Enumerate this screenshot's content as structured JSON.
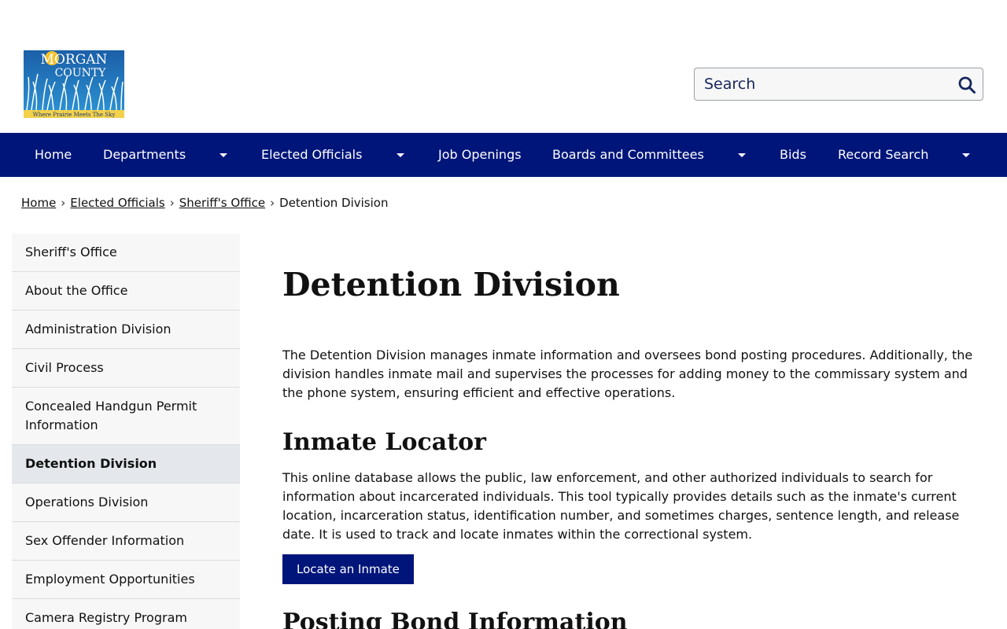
{
  "header": {
    "logo_alt": "Morgan County - Where Prairie Meets The Sky",
    "logo_title_line1": "MORGAN",
    "logo_title_line2": "COUNTY",
    "logo_tagline": "Where Prairie Meets The Sky",
    "search_placeholder": "Search"
  },
  "nav": {
    "items": [
      "Home",
      "Departments",
      "Elected Officials",
      "Job Openings",
      "Boards and Committees",
      "Bids",
      "Record Search"
    ]
  },
  "breadcrumb": {
    "items": [
      "Home",
      "Elected Officials",
      "Sheriff's Office",
      "Detention Division"
    ],
    "separator": "›"
  },
  "sidebar": {
    "items": [
      "Sheriff's Office",
      "About the Office",
      "Administration Division",
      "Civil Process",
      "Concealed Handgun Permit Information",
      "Detention Division",
      "Operations Division",
      "Sex Offender Information",
      "Employment Opportunities",
      "Camera Registry Program"
    ],
    "active": "Detention Division"
  },
  "main": {
    "title": "Detention Division",
    "intro": "The Detention Division manages inmate information and oversees bond posting procedures. Additionally, the division handles inmate mail and supervises the processes for adding money to the commissary system and the phone system, ensuring efficient and effective operations.",
    "section1_heading": "Inmate Locator",
    "section1_text": "This online database allows the public, law enforcement, and other authorized individuals to search for information about incarcerated individuals. This tool typically provides details such as the inmate's current location, incarceration status, identification number, and sometimes charges, sentence length, and release date. It is used to track and locate inmates within the correctional system.",
    "section1_button": "Locate an Inmate",
    "section2_heading": "Posting Bond Information"
  },
  "colors": {
    "nav_bg": "#00157a",
    "button_bg": "#00157a",
    "search_text": "#16265e"
  }
}
